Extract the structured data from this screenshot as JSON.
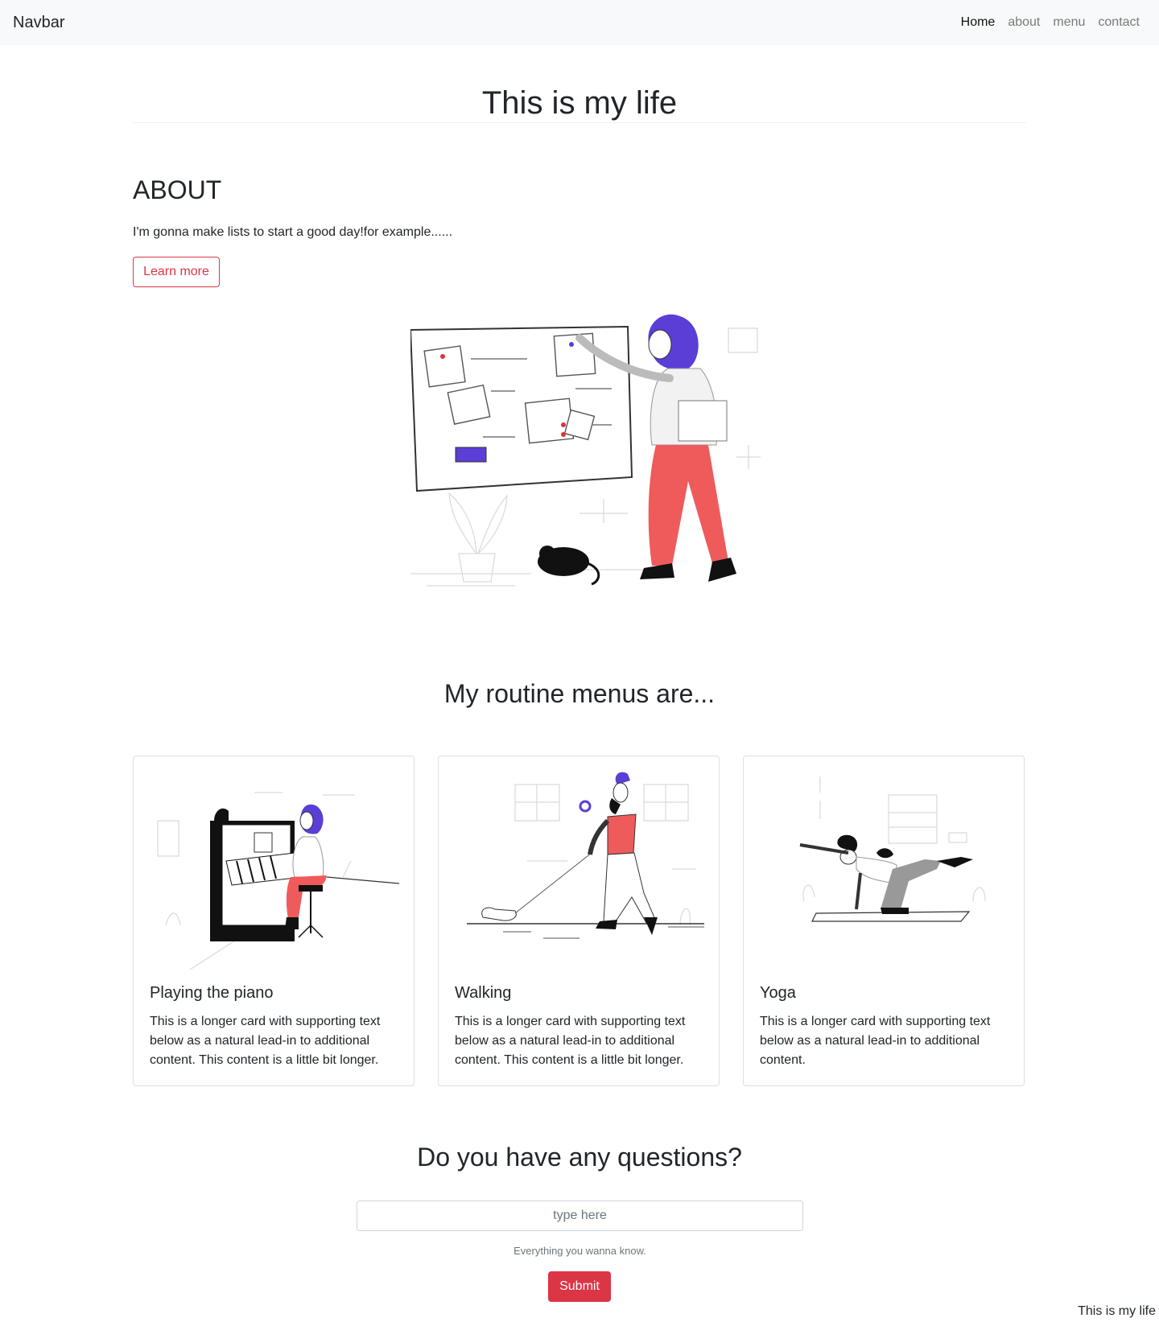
{
  "navbar": {
    "brand": "Navbar",
    "links": [
      {
        "label": "Home",
        "active": true
      },
      {
        "label": "about",
        "active": false
      },
      {
        "label": "menu",
        "active": false
      },
      {
        "label": "contact",
        "active": false
      }
    ]
  },
  "page_title": "This is my life",
  "about": {
    "heading": "ABOUT",
    "text": "I'm gonna make lists to start a good day!for example......",
    "button_label": "Learn more",
    "illustration_icon": "woman-at-pinboard-illustration"
  },
  "routine": {
    "heading": "My routine menus are...",
    "cards": [
      {
        "title": "Playing the piano",
        "text": "This is a longer card with supporting text below as a natural lead-in to additional content. This content is a little bit longer.",
        "icon": "piano-player-illustration"
      },
      {
        "title": "Walking",
        "text": "This is a longer card with supporting text below as a natural lead-in to additional content. This content is a little bit longer.",
        "icon": "dog-walker-illustration"
      },
      {
        "title": "Yoga",
        "text": "This is a longer card with supporting text below as a natural lead-in to additional content.",
        "icon": "yoga-pose-illustration"
      }
    ]
  },
  "questions": {
    "heading": "Do you have any questions?",
    "placeholder": "type here",
    "help_text": "Everything you wanna know.",
    "submit_label": "Submit"
  },
  "footer": {
    "text": "This is my life"
  },
  "colors": {
    "accent": "#dc3545",
    "illustration_purple": "#5a3ed6",
    "illustration_red": "#ef5b5b",
    "navbar_bg": "#f8f9fa"
  }
}
